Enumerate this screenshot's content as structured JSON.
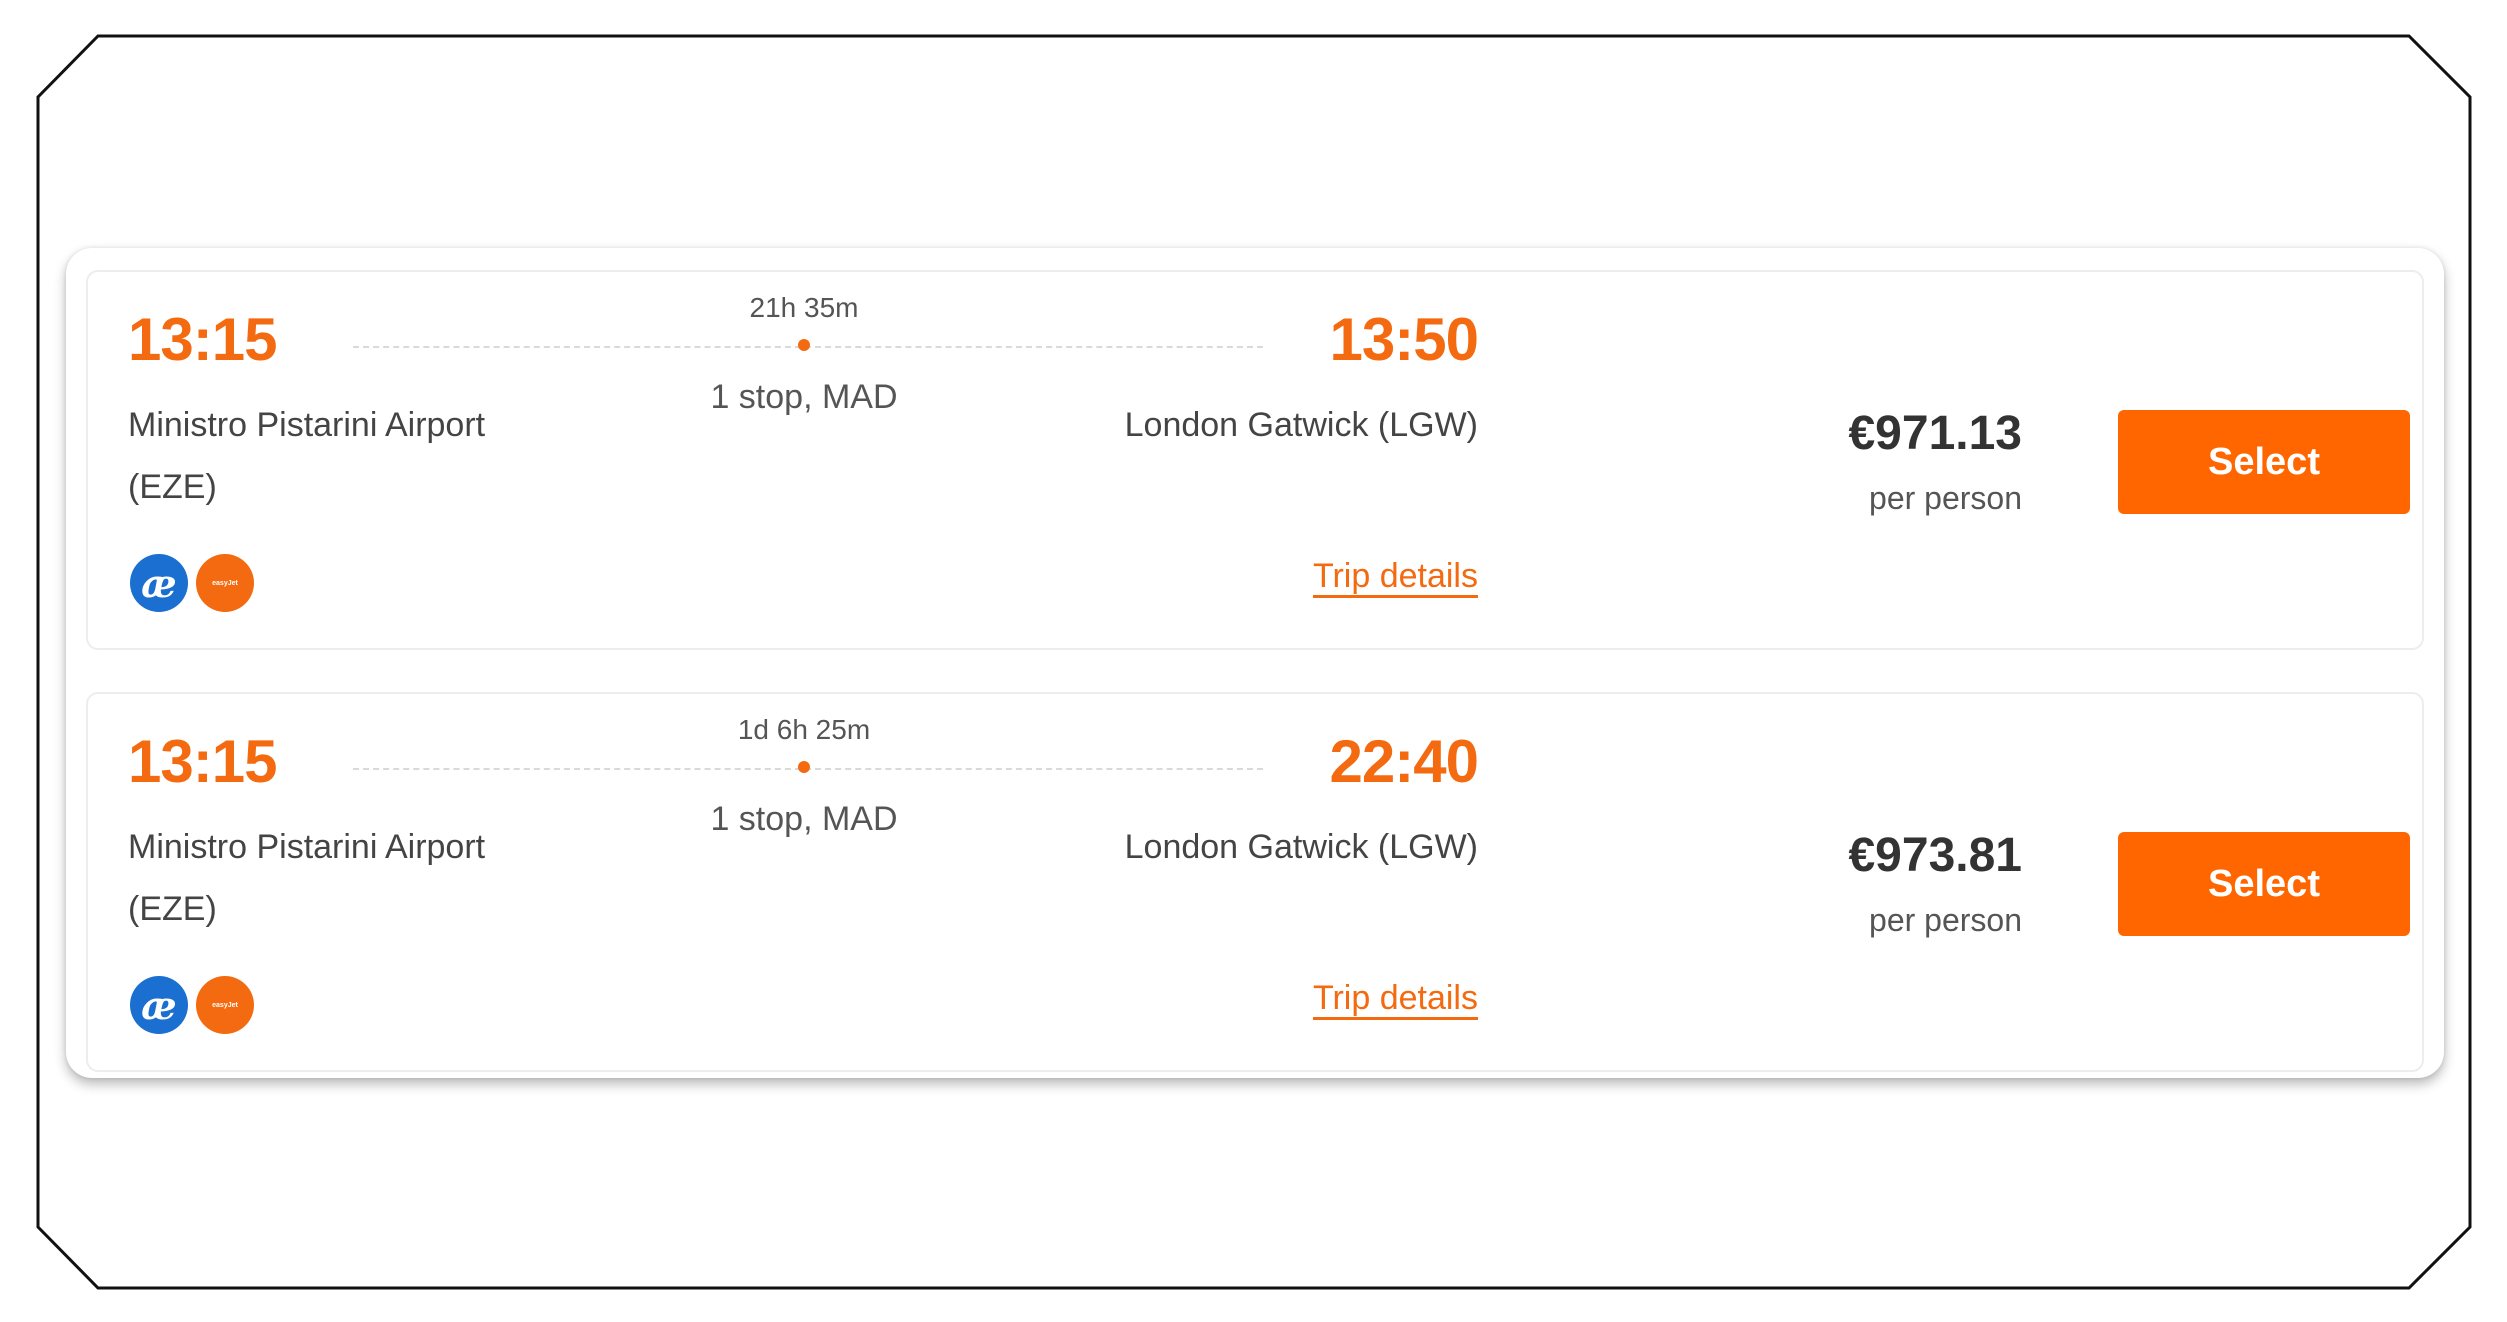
{
  "flights": [
    {
      "departure_time": "13:15",
      "arrival_time": "13:50",
      "duration": "21h 35m",
      "stops": "1 stop, MAD",
      "origin_line1": "Ministro Pistarini Airport",
      "origin_line2": "(EZE)",
      "destination": "London Gatwick (LGW)",
      "airlines": [
        "air-europa-logo",
        "easyjet-logo"
      ],
      "trip_details_label": "Trip details",
      "price": "€971.13",
      "price_unit": "per person",
      "select_label": "Select"
    },
    {
      "departure_time": "13:15",
      "arrival_time": "22:40",
      "duration": "1d 6h 25m",
      "stops": "1 stop, MAD",
      "origin_line1": "Ministro Pistarini Airport",
      "origin_line2": "(EZE)",
      "destination": "London Gatwick (LGW)",
      "airlines": [
        "air-europa-logo",
        "easyjet-logo"
      ],
      "trip_details_label": "Trip details",
      "price": "€973.81",
      "price_unit": "per person",
      "select_label": "Select"
    }
  ],
  "logos": {
    "air_europa_glyph": "æ",
    "easyjet_text": "easyJet"
  },
  "colors": {
    "accent": "#f36a10",
    "button": "#ff6600",
    "airline_blue": "#1a6fd0"
  }
}
